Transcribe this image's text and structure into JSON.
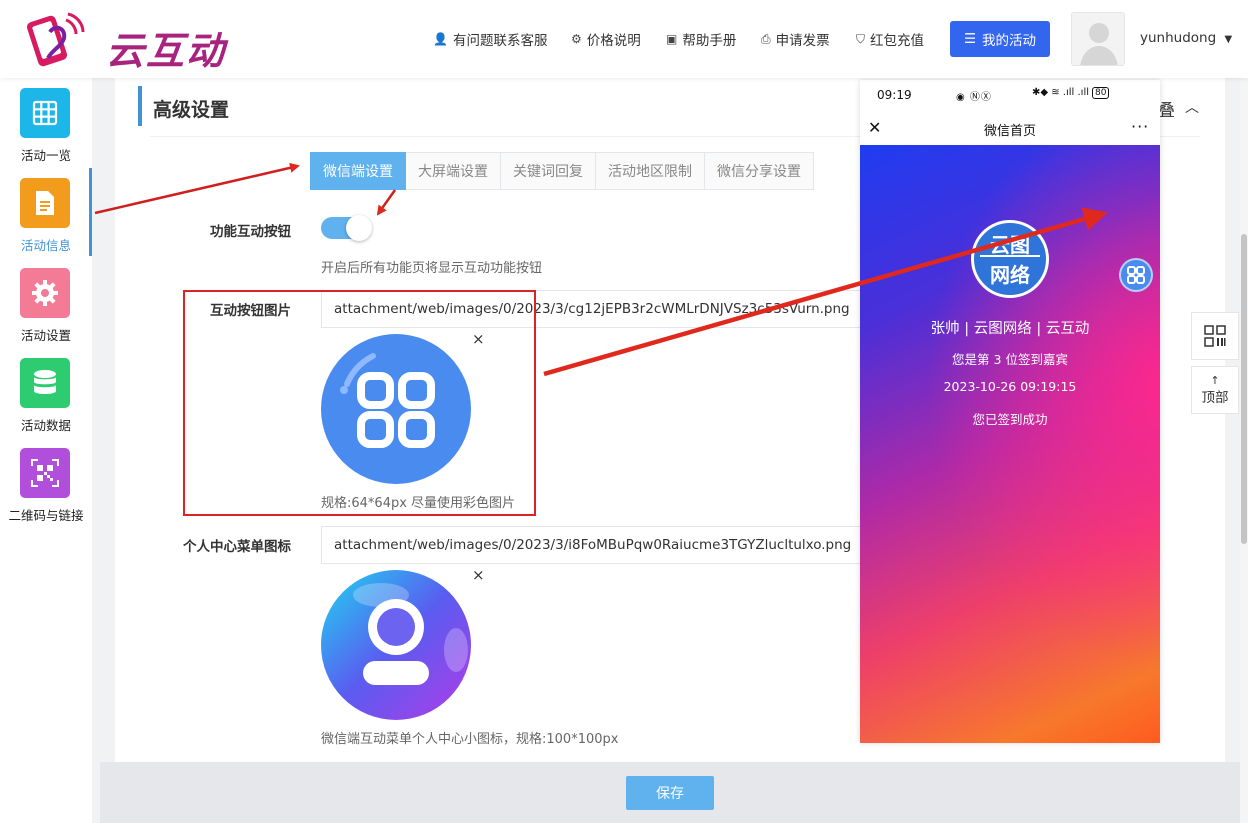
{
  "header": {
    "logo_text": "云互动",
    "nav": [
      {
        "icon": "user-plus-icon",
        "label": "有问题联系客服"
      },
      {
        "icon": "gear-icon",
        "label": "价格说明"
      },
      {
        "icon": "book-icon",
        "label": "帮助手册"
      },
      {
        "icon": "printer-icon",
        "label": "申请发票"
      },
      {
        "icon": "shield-icon",
        "label": "红包充值"
      }
    ],
    "my_activity": "我的活动",
    "username": "yunhudong"
  },
  "sidebar": {
    "items": [
      {
        "label": "活动一览",
        "color": "#1db6e8",
        "icon": "grid-icon"
      },
      {
        "label": "活动信息",
        "color": "#f39b1c",
        "icon": "document-icon",
        "active": true
      },
      {
        "label": "活动设置",
        "color": "#f47b95",
        "icon": "gear-icon"
      },
      {
        "label": "活动数据",
        "color": "#2ecc71",
        "icon": "database-icon"
      },
      {
        "label": "二维码与链接",
        "color": "#b14fdc",
        "icon": "qrcode-icon"
      }
    ]
  },
  "section": {
    "title": "高级设置",
    "collapse_label": "叠"
  },
  "tabs": [
    "微信端设置",
    "大屏端设置",
    "关键词回复",
    "活动地区限制",
    "微信分享设置"
  ],
  "form": {
    "toggle_label": "功能互动按钮",
    "toggle_hint": "开启后所有功能页将显示互动功能按钮",
    "button_image_label": "互动按钮图片",
    "button_image_value": "attachment/web/images/0/2023/3/cg12jEPB3r2cWMLrDNJVSz3c53sVurn.png",
    "button_image_hint": "规格:64*64px 尽量使用彩色图片",
    "menu_icon_label": "个人中心菜单图标",
    "menu_icon_value": "attachment/web/images/0/2023/3/i8FoMBuPqw0Raiucme3TGYZlucltulxo.png",
    "menu_icon_hint": "微信端互动菜单个人中心小图标，规格:100*100px",
    "remove": "×"
  },
  "footer": {
    "save": "保存"
  },
  "float": {
    "top_label": "顶部"
  },
  "phone": {
    "time": "09:19",
    "battery": "80",
    "title": "微信首页",
    "logo_line1": "云图",
    "logo_line2": "网络",
    "name": "张帅 | 云图网络 | 云互动",
    "rank": "您是第 3 位签到嘉宾",
    "datetime": "2023-10-26 09:19:15",
    "status": "您已签到成功"
  }
}
